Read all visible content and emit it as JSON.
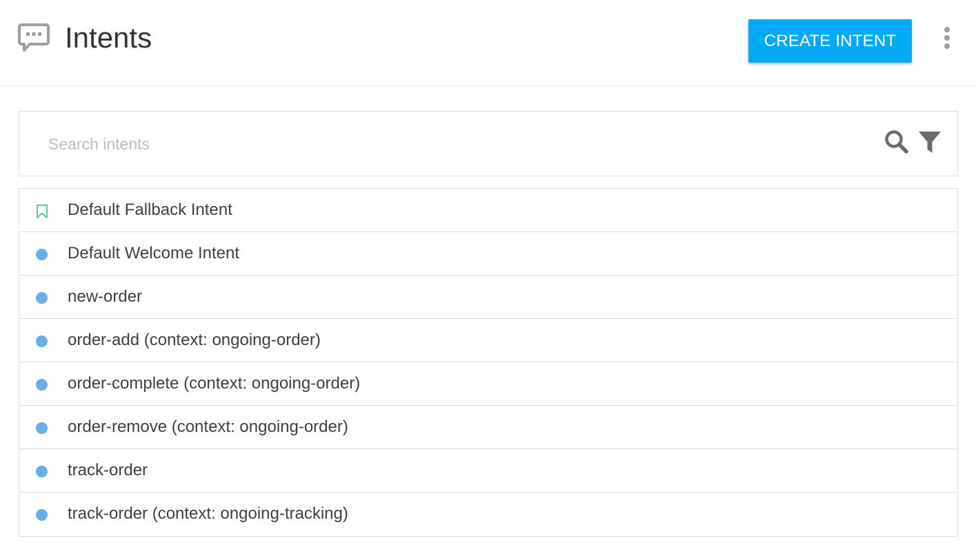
{
  "header": {
    "title": "Intents",
    "icon": "chat-bubble-icon",
    "create_button_label": "CREATE INTENT",
    "more_menu_icon": "more-vert-icon"
  },
  "search": {
    "placeholder": "Search intents",
    "value": "",
    "search_icon": "search-icon",
    "filter_icon": "filter-icon"
  },
  "colors": {
    "accent": "#03a9f4",
    "dot": "#6aaee6",
    "fallback_bookmark": "#5fc3a4",
    "icon_gray": "#9e9e9e",
    "toolbar_icon": "#6b6b6b"
  },
  "intents": [
    {
      "label": "Default Fallback Intent",
      "marker": "bookmark-icon"
    },
    {
      "label": "Default Welcome Intent",
      "marker": "dot"
    },
    {
      "label": "new-order",
      "marker": "dot"
    },
    {
      "label": "order-add (context: ongoing-order)",
      "marker": "dot"
    },
    {
      "label": "order-complete (context: ongoing-order)",
      "marker": "dot"
    },
    {
      "label": "order-remove (context: ongoing-order)",
      "marker": "dot"
    },
    {
      "label": "track-order",
      "marker": "dot"
    },
    {
      "label": "track-order (context: ongoing-tracking)",
      "marker": "dot"
    }
  ]
}
